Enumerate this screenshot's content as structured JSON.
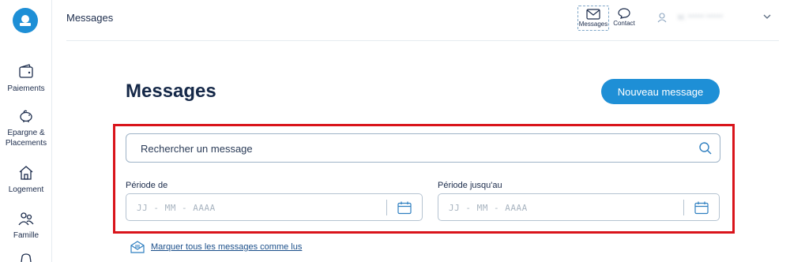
{
  "header": {
    "breadcrumb": "Messages",
    "messages_label": "Messages",
    "contact_label": "Contact",
    "user_name": "M. ****** ******"
  },
  "sidebar": {
    "items": [
      {
        "label_1": "Paiements",
        "label_2": "",
        "icon": "wallet-icon"
      },
      {
        "label_1": "Epargne &",
        "label_2": "Placements",
        "icon": "piggy-bank-icon"
      },
      {
        "label_1": "Logement",
        "label_2": "",
        "icon": "house-icon"
      },
      {
        "label_1": "Famille",
        "label_2": "",
        "icon": "family-icon"
      }
    ]
  },
  "main": {
    "title": "Messages",
    "new_message_label": "Nouveau message",
    "search_placeholder": "Rechercher un message",
    "period_from_label": "Période de",
    "period_to_label": "Période jusqu'au",
    "date_placeholder": "JJ - MM - AAAA",
    "mark_all_read": "Marquer tous les messages comme lus"
  },
  "colors": {
    "accent": "#1e8fd6",
    "text": "#1b2b4b",
    "highlight": "#d9141b"
  }
}
